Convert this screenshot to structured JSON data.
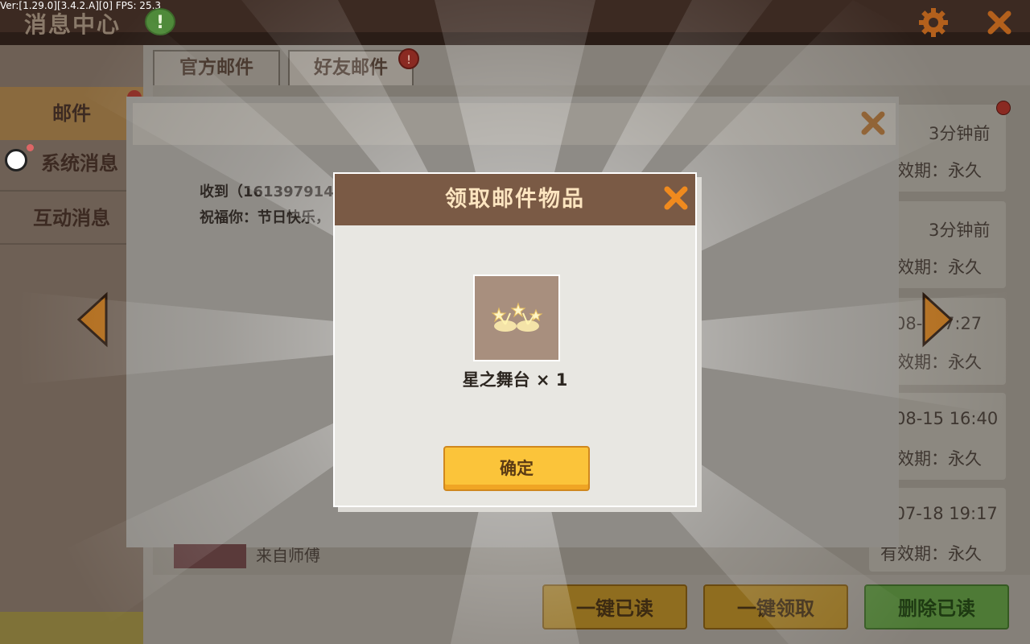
{
  "debug": {
    "version_text": "Ver:[1.29.0][3.4.2.A][0] FPS: 25.3"
  },
  "header": {
    "title": "消息中心",
    "info_symbol": "!"
  },
  "sidebar": {
    "items": [
      {
        "label": "邮件"
      },
      {
        "label": "系统消息"
      },
      {
        "label": "互动消息"
      }
    ]
  },
  "tabs": [
    {
      "label": "官方邮件"
    },
    {
      "label": "好友邮件",
      "badge": "!"
    }
  ],
  "mail_list": [
    {
      "time": "3分钟前",
      "expiry": "有效期：永久"
    },
    {
      "time": "3分钟前",
      "expiry": "有效期：永久"
    },
    {
      "time": "08-··07:27",
      "expiry": "有效期：永久"
    },
    {
      "time": "08-15 16:40",
      "expiry": "有效期：永久"
    },
    {
      "time": "-07-18 19:17",
      "expiry": "有效期：永久"
    }
  ],
  "mail_detail": {
    "from_line": "收到（1613979146）",
    "body_line": "祝福你：节日快乐，",
    "footer_from": "来自师傅"
  },
  "bottom_buttons": {
    "mark_read": "一键已读",
    "claim_all": "一键领取",
    "delete_read": "删除已读"
  },
  "reward_dialog": {
    "title": "领取邮件物品",
    "item_name": "星之舞台 × 1",
    "confirm": "确定"
  },
  "colors": {
    "accent_orange": "#f08a1e",
    "confirm_button": "#fbc43a",
    "dialog_header": "#7a5a45"
  }
}
